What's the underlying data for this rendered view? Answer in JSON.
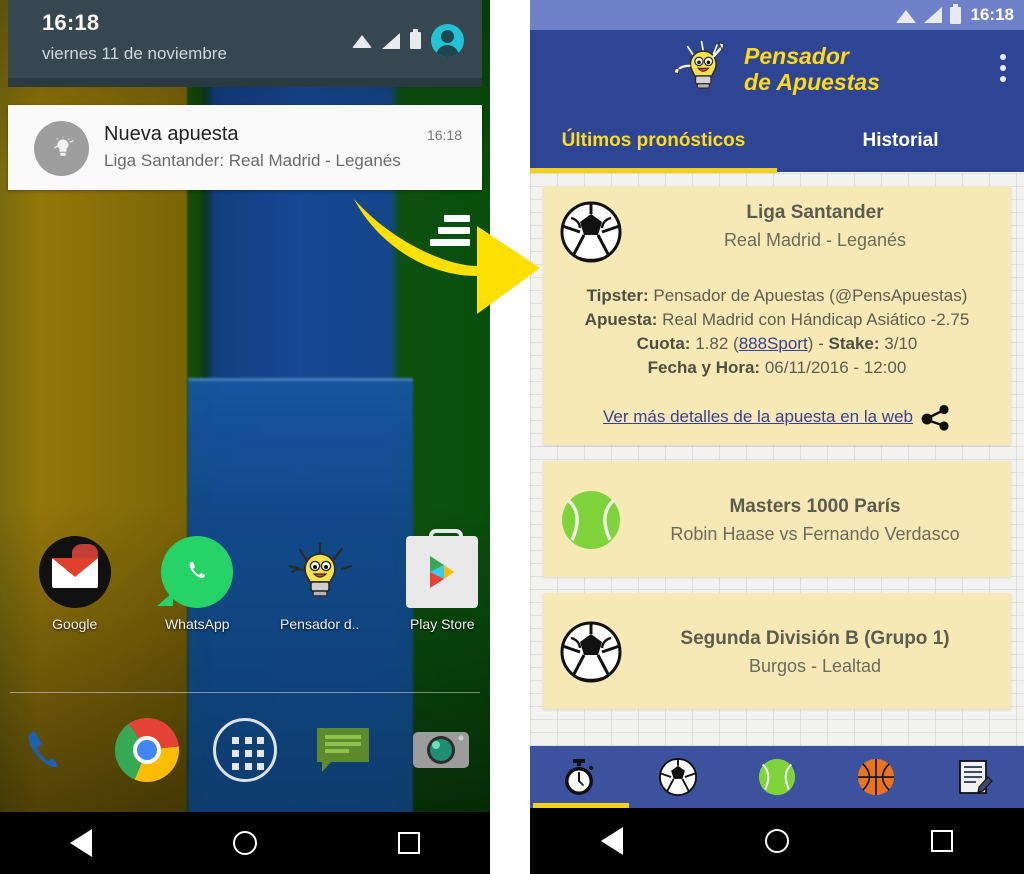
{
  "left_phone": {
    "status_shade": {
      "time": "16:18",
      "date": "viernes 11 de noviembre",
      "icons": [
        "wifi-icon",
        "signal-icon",
        "battery-icon",
        "user-avatar-icon"
      ]
    },
    "notification": {
      "title": "Nueva apuesta",
      "time": "16:18",
      "subtitle": "Liga Santander: Real Madrid - Leganés",
      "app_icon": "lightbulb-icon"
    },
    "home_apps": [
      {
        "label": "Google",
        "icon": "gmail-icon"
      },
      {
        "label": "WhatsApp",
        "icon": "whatsapp-icon"
      },
      {
        "label": "Pensador d..",
        "icon": "lightbulb-icon"
      },
      {
        "label": "Play Store",
        "icon": "play-store-icon"
      }
    ],
    "dock": [
      {
        "icon": "phone-icon"
      },
      {
        "icon": "chrome-icon"
      },
      {
        "icon": "app-drawer-icon"
      },
      {
        "icon": "messages-icon"
      },
      {
        "icon": "camera-icon"
      }
    ],
    "nav_bar": [
      "back-icon",
      "home-icon",
      "recents-icon"
    ]
  },
  "arrow": {
    "name": "yellow-arrow",
    "color": "#FFE000"
  },
  "right_phone": {
    "status_bar": {
      "time": "16:18",
      "icons": [
        "wifi-icon",
        "signal-icon",
        "battery-icon"
      ]
    },
    "app_header": {
      "logo_icon": "lightbulb-mascot-icon",
      "title_line1": "Pensador",
      "title_line2": "de Apuestas",
      "overflow_icon": "kebab-menu-icon"
    },
    "tabs": [
      {
        "label": "Últimos pronósticos",
        "active": true
      },
      {
        "label": "Historial",
        "active": false
      }
    ],
    "cards": [
      {
        "sport_icon": "soccer-ball-icon",
        "league": "Liga Santander",
        "match": "Real Madrid - Leganés",
        "fields": [
          {
            "label": "Tipster:",
            "value": "Pensador de Apuestas (@PensApuestas)"
          },
          {
            "label": "Apuesta:",
            "value": "Real Madrid con Hándicap Asiático -2.75"
          }
        ],
        "odds_label": "Cuota:",
        "odds_value": "1.82",
        "bookmaker": "888Sport",
        "stake_label": "Stake:",
        "stake_value": "3/10",
        "date_label": "Fecha y Hora:",
        "date_value": "06/11/2016 - 12:00",
        "web_link": "Ver más detalles de la apuesta en la web",
        "share_icon": "share-icon"
      },
      {
        "sport_icon": "tennis-ball-icon",
        "league": "Masters 1000 París",
        "match": "Robin Haase vs Fernando Verdasco"
      },
      {
        "sport_icon": "soccer-ball-icon",
        "league": "Segunda División B (Grupo 1)",
        "match": "Burgos - Lealtad"
      }
    ],
    "bottom_nav": [
      {
        "icon": "stopwatch-icon",
        "active": true
      },
      {
        "icon": "soccer-ball-icon",
        "active": false
      },
      {
        "icon": "tennis-ball-icon",
        "active": false
      },
      {
        "icon": "basketball-icon",
        "active": false
      },
      {
        "icon": "notes-icon",
        "active": false
      }
    ],
    "nav_bar": [
      "back-icon",
      "home-icon",
      "recents-icon"
    ]
  },
  "colors": {
    "header_blue": "#2E4593",
    "status_blue": "#6F81C9",
    "accent_yellow": "#F2D117",
    "card_cream": "#F6E9B5",
    "link_blue": "#3B3F8F"
  }
}
